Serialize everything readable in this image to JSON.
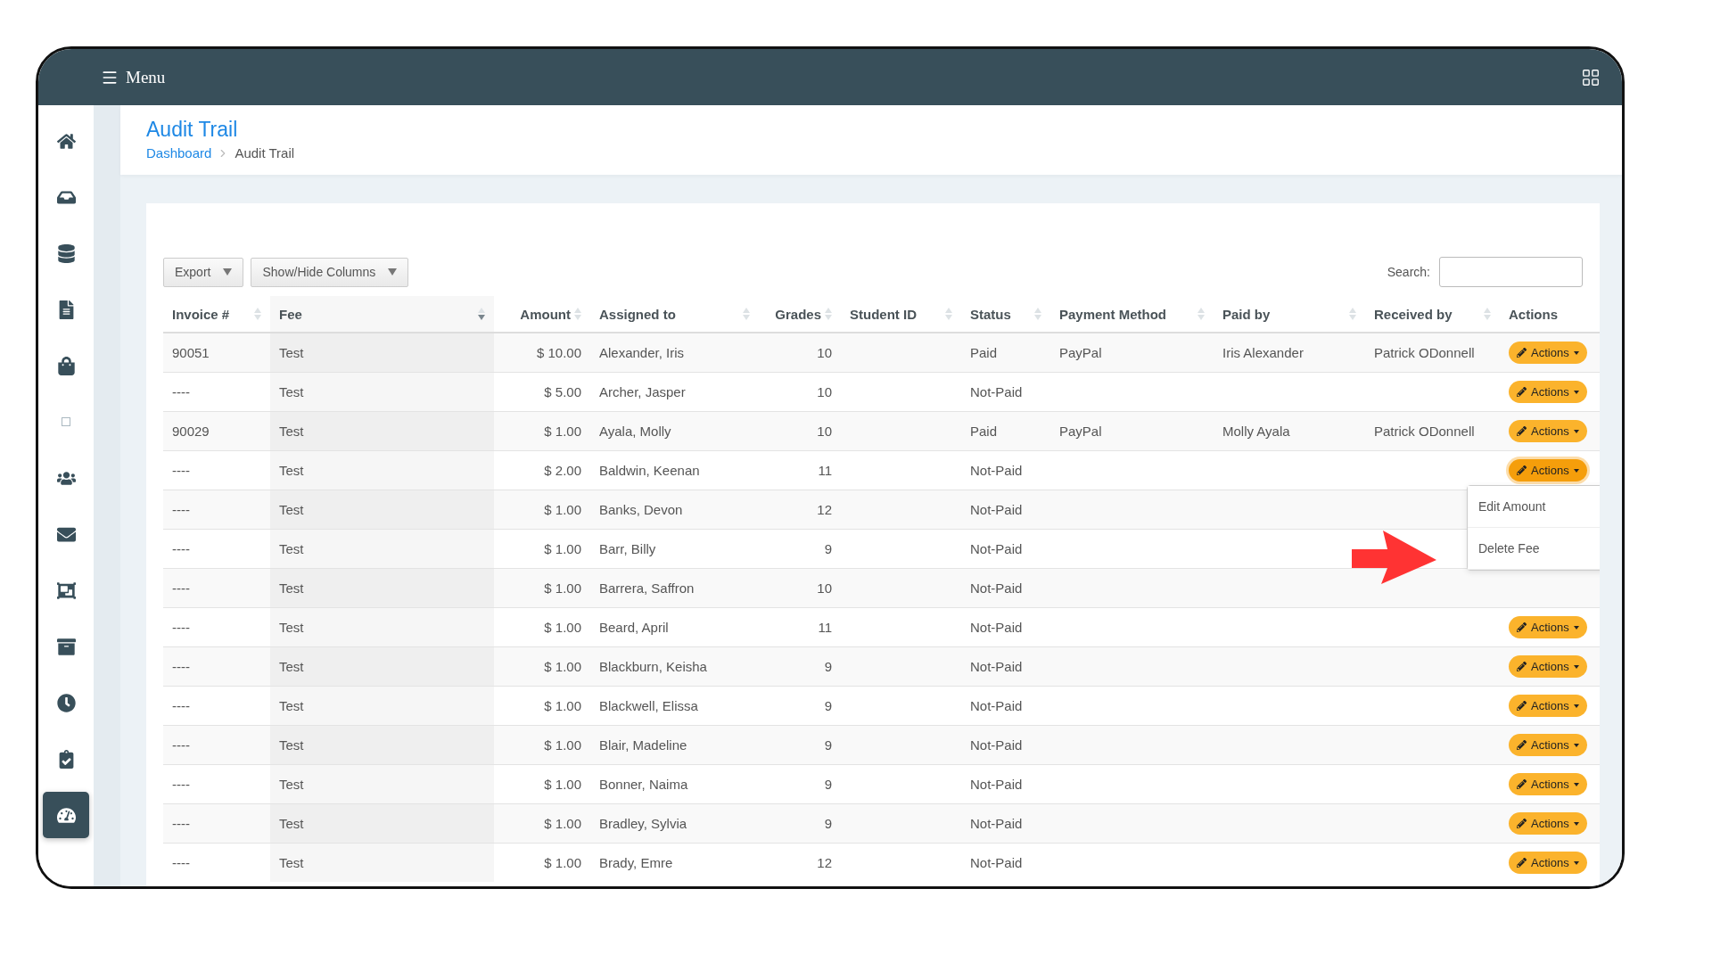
{
  "topbar": {
    "menu_label": "Menu"
  },
  "sidebar": {
    "items": [
      {
        "selected": false
      },
      {
        "selected": false
      },
      {
        "selected": false
      },
      {
        "selected": false
      },
      {
        "selected": false
      },
      {
        "selected": false
      },
      {
        "selected": false
      },
      {
        "selected": false
      },
      {
        "selected": false
      },
      {
        "selected": false
      },
      {
        "selected": false
      },
      {
        "selected": false
      },
      {
        "selected": true
      }
    ]
  },
  "header": {
    "title": "Audit Trail",
    "breadcrumb": [
      "Dashboard",
      "Audit Trail"
    ]
  },
  "toolbar": {
    "buttons": [
      "Export",
      "Show/Hide Columns"
    ],
    "search_label": "Search:"
  },
  "table": {
    "columns": [
      {
        "label": "Invoice #",
        "kind": "sortable",
        "sorted": false
      },
      {
        "label": "Fee",
        "kind": "sortable",
        "sorted": true
      },
      {
        "label": "Amount",
        "kind": "sortable",
        "sorted": false
      },
      {
        "label": "Assigned to",
        "kind": "sortable",
        "sorted": false
      },
      {
        "label": "Grades",
        "kind": "sortable",
        "sorted": false
      },
      {
        "label": "Student ID",
        "kind": "sortable",
        "sorted": false
      },
      {
        "label": "Status",
        "kind": "sortable",
        "sorted": false
      },
      {
        "label": "Payment Method",
        "kind": "sortable",
        "sorted": false
      },
      {
        "label": "Paid by",
        "kind": "sortable",
        "sorted": false
      },
      {
        "label": "Received by",
        "kind": "sortable",
        "sorted": false
      },
      {
        "label": "Actions",
        "kind": "plain"
      }
    ],
    "rows": [
      {
        "cells": [
          "90051",
          "Test",
          "$ 10.00",
          "Alexander, Iris",
          "10",
          "",
          "Paid",
          "PayPal",
          "Iris Alexander",
          "Patrick ODonnell"
        ],
        "action": "Actions",
        "menu_open": false
      },
      {
        "cells": [
          "----",
          "Test",
          "$ 5.00",
          "Archer, Jasper",
          "10",
          "",
          "Not-Paid",
          "",
          "",
          ""
        ],
        "action": "Actions",
        "menu_open": false
      },
      {
        "cells": [
          "90029",
          "Test",
          "$ 1.00",
          "Ayala, Molly",
          "10",
          "",
          "Paid",
          "PayPal",
          "Molly Ayala",
          "Patrick ODonnell"
        ],
        "action": "Actions",
        "menu_open": false
      },
      {
        "cells": [
          "----",
          "Test",
          "$ 2.00",
          "Baldwin, Keenan",
          "11",
          "",
          "Not-Paid",
          "",
          "",
          ""
        ],
        "action": "Actions",
        "menu_open": true
      },
      {
        "cells": [
          "----",
          "Test",
          "$ 1.00",
          "Banks, Devon",
          "12",
          "",
          "Not-Paid",
          "",
          "",
          ""
        ],
        "action": "",
        "menu_open": false
      },
      {
        "cells": [
          "----",
          "Test",
          "$ 1.00",
          "Barr, Billy",
          "9",
          "",
          "Not-Paid",
          "",
          "",
          ""
        ],
        "action": "",
        "menu_open": false
      },
      {
        "cells": [
          "----",
          "Test",
          "$ 1.00",
          "Barrera, Saffron",
          "10",
          "",
          "Not-Paid",
          "",
          "",
          ""
        ],
        "action": "",
        "menu_open": false
      },
      {
        "cells": [
          "----",
          "Test",
          "$ 1.00",
          "Beard, April",
          "11",
          "",
          "Not-Paid",
          "",
          "",
          ""
        ],
        "action": "Actions",
        "menu_open": false
      },
      {
        "cells": [
          "----",
          "Test",
          "$ 1.00",
          "Blackburn, Keisha",
          "9",
          "",
          "Not-Paid",
          "",
          "",
          ""
        ],
        "action": "Actions",
        "menu_open": false
      },
      {
        "cells": [
          "----",
          "Test",
          "$ 1.00",
          "Blackwell, Elissa",
          "9",
          "",
          "Not-Paid",
          "",
          "",
          ""
        ],
        "action": "Actions",
        "menu_open": false
      },
      {
        "cells": [
          "----",
          "Test",
          "$ 1.00",
          "Blair, Madeline",
          "9",
          "",
          "Not-Paid",
          "",
          "",
          ""
        ],
        "action": "Actions",
        "menu_open": false
      },
      {
        "cells": [
          "----",
          "Test",
          "$ 1.00",
          "Bonner, Naima",
          "9",
          "",
          "Not-Paid",
          "",
          "",
          ""
        ],
        "action": "Actions",
        "menu_open": false
      },
      {
        "cells": [
          "----",
          "Test",
          "$ 1.00",
          "Bradley, Sylvia",
          "9",
          "",
          "Not-Paid",
          "",
          "",
          ""
        ],
        "action": "Actions",
        "menu_open": false
      },
      {
        "cells": [
          "----",
          "Test",
          "$ 1.00",
          "Brady, Emre",
          "12",
          "",
          "Not-Paid",
          "",
          "",
          ""
        ],
        "action": "Actions",
        "menu_open": false
      }
    ]
  },
  "dropdown": {
    "items": [
      "Edit Amount",
      "Delete Fee"
    ]
  }
}
